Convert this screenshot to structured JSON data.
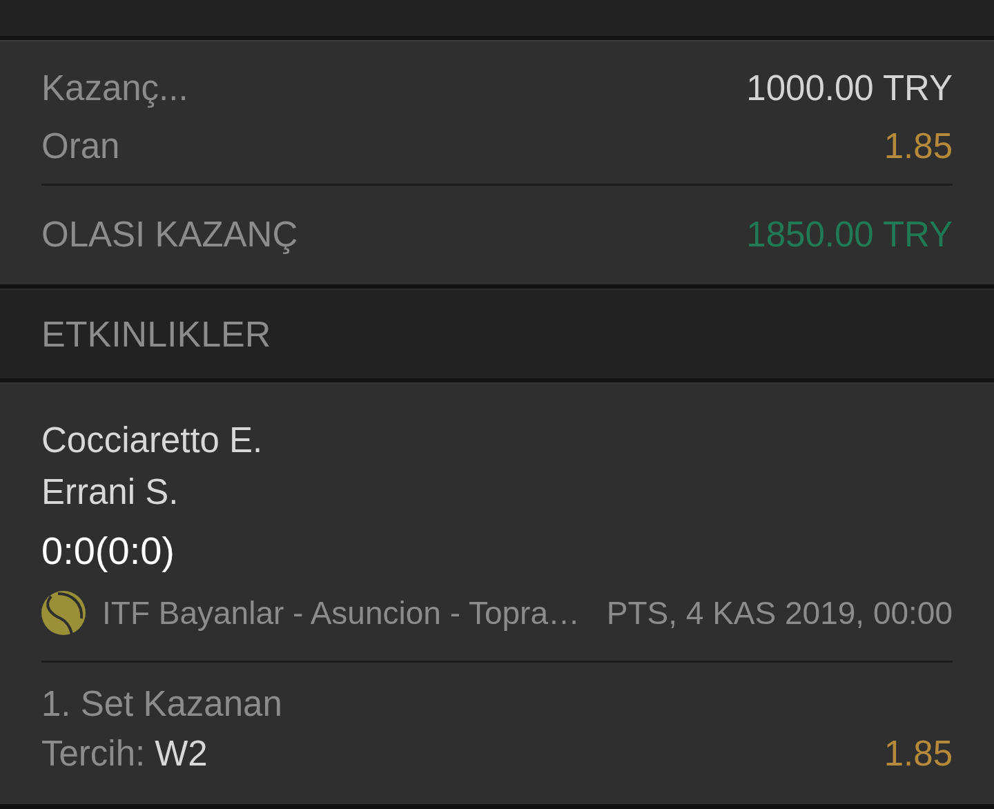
{
  "summary": {
    "rows": [
      {
        "label": "Kazanç...",
        "value": "1000.00 TRY",
        "kind": "amount"
      },
      {
        "label": "Oran",
        "value": "1.85",
        "kind": "odds"
      }
    ],
    "total": {
      "label": "OLASI KAZANÇ",
      "value": "1850.00 TRY"
    }
  },
  "events_header": {
    "title": "ETKINLIKLER"
  },
  "events": [
    {
      "teams": [
        "Cocciaretto E.",
        "Errani S."
      ],
      "score": "0:0(0:0)",
      "league": "ITF Bayanlar - Asuncion - Topra…",
      "date": "PTS, 4 KAS 2019, 00:00",
      "market": "1. Set Kazanan",
      "pick_label": "Tercih:",
      "pick": "W2",
      "odds": "1.85"
    }
  ]
}
